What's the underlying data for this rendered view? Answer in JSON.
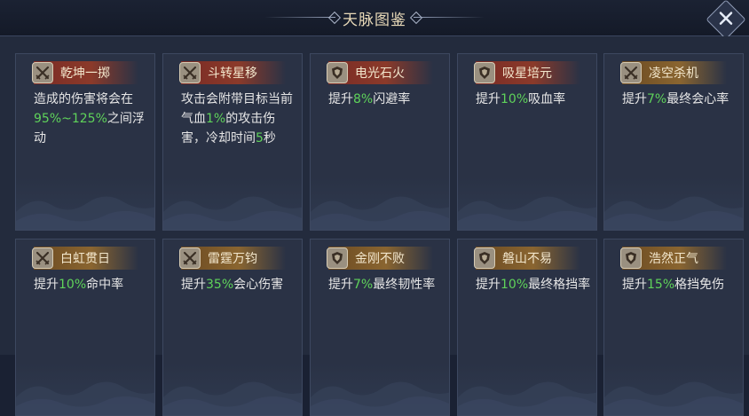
{
  "header": {
    "title": "天脉图鉴"
  },
  "colors": {
    "highlight": "#5fd35a",
    "text": "#e6e6e6",
    "header_red": "#8b3a2a",
    "header_gold": "#8a6530"
  },
  "cards": [
    {
      "name": "乾坤一掷",
      "icon": "crossed-swords-icon",
      "style": "red",
      "desc": [
        {
          "t": "造成的伤害将会在"
        },
        {
          "t": "95%~125%",
          "g": true
        },
        {
          "t": "之间浮动"
        }
      ]
    },
    {
      "name": "斗转星移",
      "icon": "crossed-swords-icon",
      "style": "red",
      "desc": [
        {
          "t": "攻击会附带目标当前气血"
        },
        {
          "t": "1%",
          "g": true
        },
        {
          "t": "的攻击伤害，冷却时间"
        },
        {
          "t": "5",
          "g": true
        },
        {
          "t": "秒"
        }
      ]
    },
    {
      "name": "电光石火",
      "icon": "shield-icon",
      "style": "red",
      "desc": [
        {
          "t": "提升"
        },
        {
          "t": "8%",
          "g": true
        },
        {
          "t": "闪避率"
        }
      ]
    },
    {
      "name": "吸星培元",
      "icon": "shield-icon",
      "style": "red",
      "desc": [
        {
          "t": "提升"
        },
        {
          "t": "10%",
          "g": true
        },
        {
          "t": "吸血率"
        }
      ]
    },
    {
      "name": "凌空杀机",
      "icon": "crossed-swords-icon",
      "style": "gold",
      "desc": [
        {
          "t": "提升"
        },
        {
          "t": "7%",
          "g": true
        },
        {
          "t": "最终会心率"
        }
      ]
    },
    {
      "name": "白虹贯日",
      "icon": "crossed-swords-icon",
      "style": "gold",
      "desc": [
        {
          "t": "提升"
        },
        {
          "t": "10%",
          "g": true
        },
        {
          "t": "命中率"
        }
      ]
    },
    {
      "name": "雷霆万钧",
      "icon": "crossed-swords-icon",
      "style": "gold",
      "desc": [
        {
          "t": "提升"
        },
        {
          "t": "35%",
          "g": true
        },
        {
          "t": "会心伤害"
        }
      ]
    },
    {
      "name": "金刚不败",
      "icon": "shield-icon",
      "style": "gold",
      "desc": [
        {
          "t": "提升"
        },
        {
          "t": "7%",
          "g": true
        },
        {
          "t": "最终韧性率"
        }
      ]
    },
    {
      "name": "磐山不易",
      "icon": "shield-icon",
      "style": "gold",
      "desc": [
        {
          "t": "提升"
        },
        {
          "t": "10%",
          "g": true
        },
        {
          "t": "最终格挡率"
        }
      ]
    },
    {
      "name": "浩然正气",
      "icon": "shield-icon",
      "style": "gold",
      "desc": [
        {
          "t": "提升"
        },
        {
          "t": "15%",
          "g": true
        },
        {
          "t": "格挡免伤"
        }
      ]
    }
  ]
}
